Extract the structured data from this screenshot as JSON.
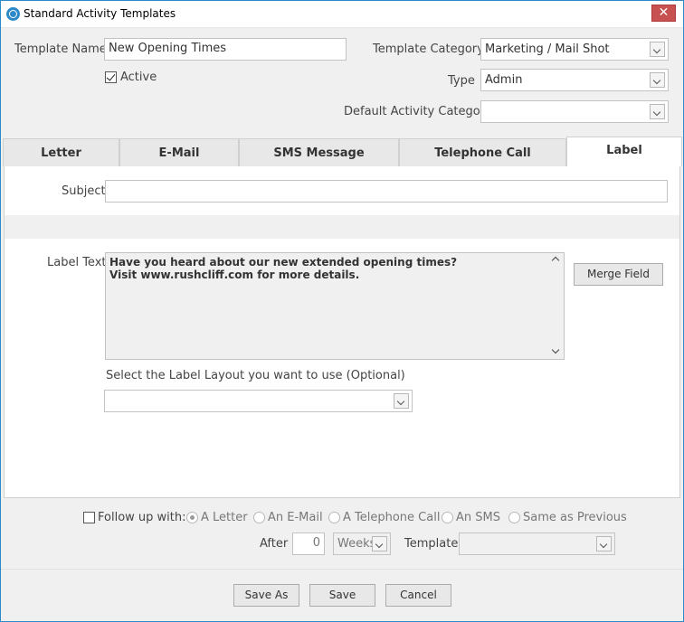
{
  "window": {
    "title": "Standard Activity Templates",
    "close_icon": "✕"
  },
  "header": {
    "template_name_label": "Template Name",
    "template_name_value": "New Opening Times",
    "active_label": "Active",
    "active_checked": true,
    "template_category_label": "Template Category",
    "template_category_value": "Marketing / Mail Shot",
    "type_label": "Type",
    "type_value": "Admin",
    "default_activity_category_label": "Default Activity Category",
    "default_activity_category_value": ""
  },
  "tabs": [
    {
      "label": "Letter"
    },
    {
      "label": "E-Mail"
    },
    {
      "label": "SMS Message"
    },
    {
      "label": "Telephone Call"
    },
    {
      "label": "Label",
      "active": true
    }
  ],
  "label_tab": {
    "subject_label": "Subject",
    "subject_value": "",
    "label_text_label": "Label Text",
    "label_text_line1": "Have you heard about our new extended opening times?",
    "label_text_line2": "Visit www.rushcliff.com for more details.",
    "merge_field_button": "Merge Field",
    "layout_prompt": "Select the Label Layout you want to use (Optional)",
    "layout_value": ""
  },
  "follow_up": {
    "label": "Follow up with:",
    "checked": false,
    "options": [
      "A Letter",
      "An E-Mail",
      "A Telephone Call",
      "An SMS",
      "Same as Previous"
    ],
    "selected": "A Letter",
    "after_label": "After",
    "after_value": "0",
    "unit_value": "Weeks",
    "template_label": "Template",
    "template_value": ""
  },
  "footer": {
    "save_as": "Save As",
    "save": "Save",
    "cancel": "Cancel"
  }
}
